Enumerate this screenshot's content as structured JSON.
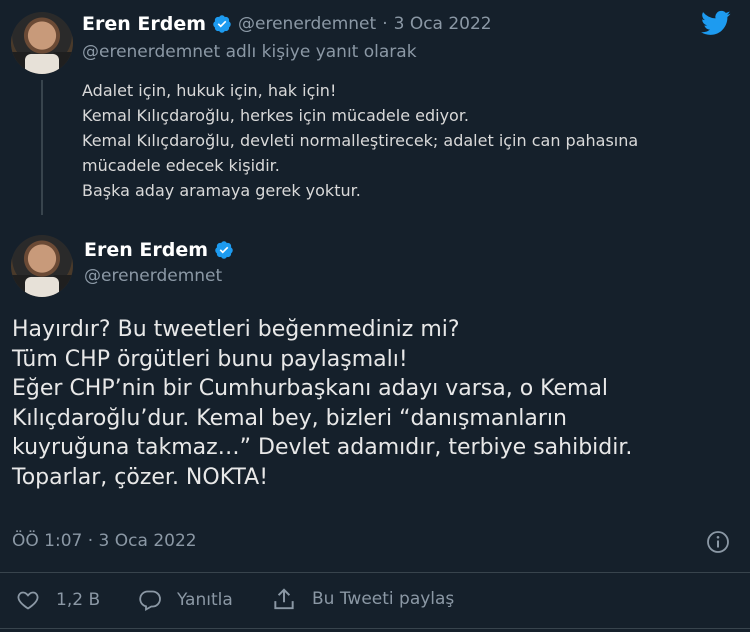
{
  "reply_tweet": {
    "author_name": "Eren Erdem",
    "author_handle": "@erenerdemnet",
    "separator": "·",
    "date": "3 Oca 2022",
    "reply_context": "@erenerdemnet adlı kişiye yanıt olarak",
    "lines": [
      "Adalet için, hukuk için, hak için!",
      "Kemal Kılıçdaroğlu, herkes için mücadele ediyor.",
      "Kemal Kılıçdaroğlu, devleti normalleştirecek; adalet için can pahasına",
      "mücadele edecek kişidir.",
      "Başka aday aramaya gerek yoktur."
    ]
  },
  "main_tweet": {
    "author_name": "Eren Erdem",
    "author_handle": "@erenerdemnet",
    "lines": [
      "Hayırdır? Bu tweetleri beğenmediniz mi?",
      "Tüm CHP örgütleri bunu paylaşmalı!",
      "Eğer CHP’nin bir Cumhurbaşkanı adayı varsa, o Kemal",
      "Kılıçdaroğlu’dur. Kemal bey, bizleri “danışmanların",
      "kuyruğuna takmaz…” Devlet adamıdır, terbiye sahibidir.",
      "Toparlar, çözer. NOKTA!"
    ],
    "timestamp": "ÖÖ 1:07 · 3 Oca 2022",
    "like_count": "1,2 B",
    "reply_label": "Yanıtla",
    "share_label": "Bu Tweeti paylaş"
  },
  "icons": {
    "verified": "verified-badge-icon",
    "twitter": "twitter-bird-icon",
    "info": "info-icon",
    "like": "heart-icon",
    "reply": "reply-bubble-icon",
    "share": "share-icon"
  },
  "colors": {
    "background": "#15202b",
    "brand_blue": "#1d9bf0",
    "muted": "#8b98a5"
  }
}
